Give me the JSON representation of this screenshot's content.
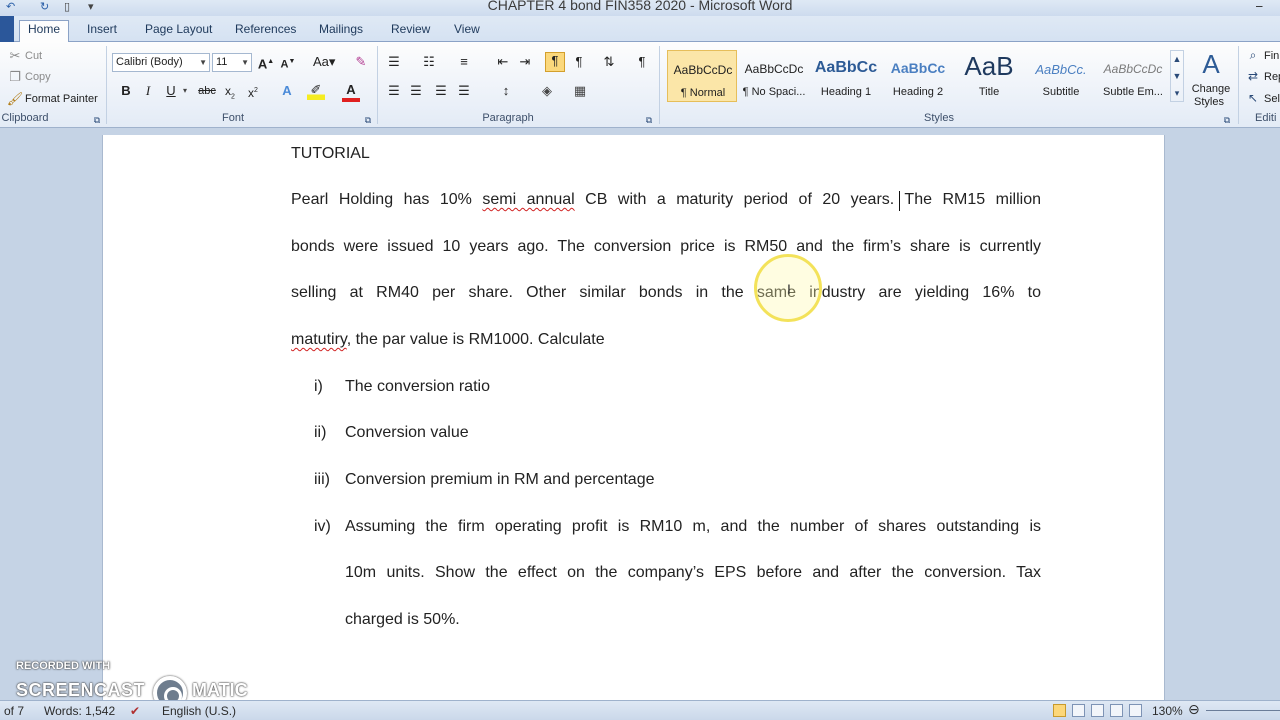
{
  "window": {
    "title": "CHAPTER 4 bond FIN358 2020  -  Microsoft Word"
  },
  "tabs": [
    "Home",
    "Insert",
    "Page Layout",
    "References",
    "Mailings",
    "Review",
    "View"
  ],
  "clipboard": {
    "cut": "Cut",
    "copy": "Copy",
    "format_painter": "Format Painter",
    "label": "Clipboard"
  },
  "font": {
    "family": "Calibri (Body)",
    "size": "11",
    "label": "Font"
  },
  "paragraph": {
    "label": "Paragraph"
  },
  "styles": {
    "label": "Styles",
    "items": [
      {
        "sample": "AaBbCcDc",
        "name": "¶ Normal"
      },
      {
        "sample": "AaBbCcDc",
        "name": "¶ No Spaci..."
      },
      {
        "sample": "AaBbCc",
        "name": "Heading 1"
      },
      {
        "sample": "AaBbCc",
        "name": "Heading 2"
      },
      {
        "sample": "AaB",
        "name": "Title"
      },
      {
        "sample": "AaBbCc.",
        "name": "Subtitle"
      },
      {
        "sample": "AaBbCcDc",
        "name": "Subtle Em..."
      }
    ],
    "change_styles": [
      "Change",
      "Styles"
    ]
  },
  "editing": {
    "label": "Editi",
    "find": "Fin",
    "replace": "Rep",
    "select": "Sel"
  },
  "document": {
    "heading": "TUTORIAL",
    "para_lines": [
      [
        "Pearl Holding has 10% ",
        "semi annual",
        " CB with a maturity period of 20 years. The RM15 million"
      ],
      [
        "bonds were issued 10 years ago. The conversion price is RM50 and the firm’s share is currently"
      ],
      [
        "selling at RM40 per share. Other similar bonds in the same industry are yielding 16% to"
      ],
      [
        "",
        "matutiry",
        ", the par value is RM1000. Calculate"
      ]
    ],
    "items": [
      {
        "num": "i)",
        "lines": [
          "The conversion ratio"
        ]
      },
      {
        "num": "ii)",
        "lines": [
          "Conversion value"
        ]
      },
      {
        "num": "iii)",
        "lines": [
          "Conversion premium in RM and percentage"
        ]
      },
      {
        "num": "iv)",
        "lines": [
          "Assuming the firm operating profit is RM10 m, and the number of shares outstanding is",
          "10m units. Show the effect on the company’s EPS before and after the conversion. Tax",
          "charged is 50%."
        ]
      }
    ]
  },
  "status": {
    "page": "of 7",
    "words": "Words: 1,542",
    "language": "English (U.S.)",
    "zoom": "130%"
  },
  "watermark": {
    "line1": "RECORDED WITH",
    "part1": "SCREENCAST",
    "part2": "MATIC"
  }
}
